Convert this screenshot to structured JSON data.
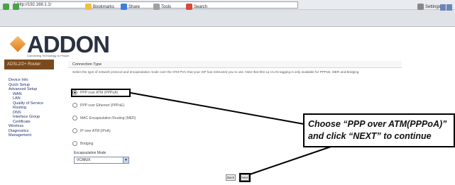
{
  "browser": {
    "address": "http://192.168.1.1/",
    "toolbar_items": [
      "Bookmarks",
      "Share",
      "Tools",
      "Search",
      "Settings"
    ]
  },
  "brand": {
    "logo_text": "ADDON",
    "tagline": "Connecting Technology to People"
  },
  "nav": {
    "header": "ADSL2/2+ Router",
    "items": [
      {
        "label": "Device Info",
        "sub": false
      },
      {
        "label": "Quick Setup",
        "sub": false
      },
      {
        "label": "Advanced Setup",
        "sub": false
      },
      {
        "label": "WAN",
        "sub": true
      },
      {
        "label": "LAN",
        "sub": true
      },
      {
        "label": "Quality of Service",
        "sub": true
      },
      {
        "label": "Routing",
        "sub": true
      },
      {
        "label": "DNS",
        "sub": true
      },
      {
        "label": "Interface Group",
        "sub": true
      },
      {
        "label": "Certificate",
        "sub": true
      },
      {
        "label": "Wireless",
        "sub": false
      },
      {
        "label": "Diagnostics",
        "sub": false
      },
      {
        "label": "Management",
        "sub": false
      }
    ]
  },
  "main": {
    "title": "Connection Type",
    "description": "Select the type of network protocol and encapsulation mode over the ATM PVC that your ISP has instructed you to use. Note that 802.1q VLAN tagging is only available for PPPoE, MER and Bridging.",
    "options": [
      {
        "label": "PPP over ATM (PPPoA)",
        "selected": true
      },
      {
        "label": "PPP over Ethernet (PPPoE)",
        "selected": false
      },
      {
        "label": "MAC Encapsulation Routing (MER)",
        "selected": false
      },
      {
        "label": "IP over ATM (IPoA)",
        "selected": false
      },
      {
        "label": "Bridging",
        "selected": false
      }
    ],
    "encap_label": "Encapsulation Mode",
    "encap_value": "VC/MUX",
    "back_label": "Back",
    "next_label": "Next"
  },
  "callout": {
    "line1": "Choose “PPP over ATM(PPPoA)”",
    "line2": "and click “NEXT” to continue"
  }
}
